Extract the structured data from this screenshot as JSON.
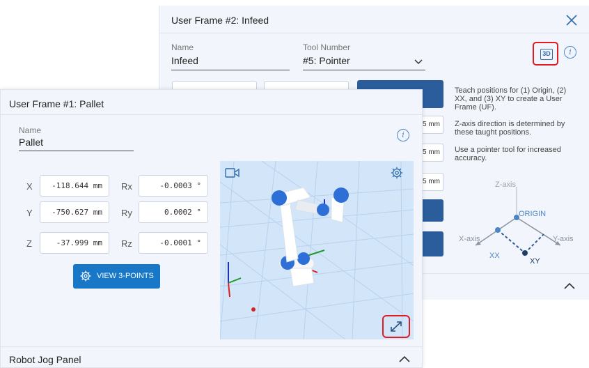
{
  "frame2": {
    "title": "User Frame #2: Infeed",
    "name_label": "Name",
    "name_value": "Infeed",
    "tool_label": "Tool Number",
    "tool_value": "#5: Pointer",
    "unit_1": "5 mm",
    "unit_2": "5 mm",
    "unit_3": "5 mm",
    "help": [
      "Teach positions for (1) Origin, (2) XX, and (3) XY to create a User Frame (UF).",
      "Z-axis direction is determined by these taught positions.",
      "Use a pointer tool for increased accuracy."
    ],
    "diagram": {
      "z_axis": "Z-axis",
      "origin": "ORIGIN",
      "x_axis": "X-axis",
      "y_axis": "Y-axis",
      "xx": "XX",
      "xy": "XY"
    },
    "btn_3d_label": "3D"
  },
  "frame1": {
    "title": "User Frame #1: Pallet",
    "name_label": "Name",
    "name_value": "Pallet",
    "coords": {
      "x_label": "X",
      "x_value": "-118.644 mm",
      "y_label": "Y",
      "y_value": "-750.627 mm",
      "z_label": "Z",
      "z_value": "-37.999 mm",
      "rx_label": "Rx",
      "rx_value": "-0.0003 °",
      "ry_label": "Ry",
      "ry_value": "0.0002 °",
      "rz_label": "Rz",
      "rz_value": "-0.0001 °"
    },
    "view_button": "VIEW 3-POINTS"
  },
  "jog_panel": {
    "title": "Robot Jog Panel"
  },
  "colors": {
    "accent": "#1877c6",
    "dark_blue": "#2b5d9c",
    "highlight": "#e11b22",
    "viewport_bg": "#d3e5f8"
  },
  "icons": [
    "close-icon",
    "3d-view-icon",
    "info-icon",
    "chevron-down-icon",
    "chevron-up-icon",
    "camera-icon",
    "settings-gear-icon",
    "expand-icon"
  ]
}
